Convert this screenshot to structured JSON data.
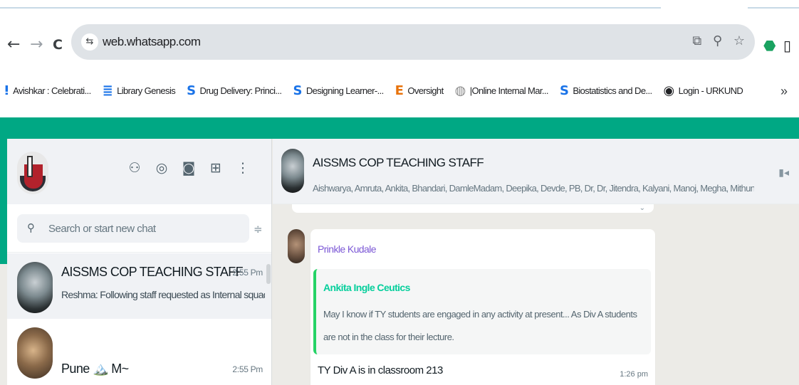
{
  "browser": {
    "nav": {
      "back_icon": "←",
      "forward_icon": "→",
      "reload_icon": "C"
    },
    "omnibox": {
      "site_info_icon": "⇆",
      "url": "web.whatsapp.com",
      "icons": [
        "install-app-icon",
        "zoom-icon",
        "bookmark-star-icon"
      ]
    },
    "extensions": [
      "extension-icon",
      "side-panel-icon"
    ],
    "bookmarks": [
      {
        "icon": "ⵑ",
        "icon_name": "avishkar-favicon",
        "label": "Avishkar : Celebrati...",
        "color": "#1a73e8"
      },
      {
        "icon": "≣",
        "icon_name": "library-genesis-favicon",
        "label": "Library Genesis",
        "color": "#1a73e8"
      },
      {
        "icon": "S",
        "icon_name": "scribd-favicon",
        "label": "Drug Delivery: Princi...",
        "color": "#1a73e8"
      },
      {
        "icon": "S",
        "icon_name": "scribd-favicon",
        "label": "Designing Learner-...",
        "color": "#1a73e8"
      },
      {
        "icon": "E",
        "icon_name": "oversight-favicon",
        "label": "Oversight",
        "color": "#e8730c"
      },
      {
        "icon": "◍",
        "icon_name": "online-internal-favicon",
        "label": "|Online Internal Mar...",
        "color": "#8a8a8a"
      },
      {
        "icon": "S",
        "icon_name": "scribd-favicon",
        "label": "Biostatistics and De...",
        "color": "#1a73e8"
      },
      {
        "icon": "◉",
        "icon_name": "urkund-favicon",
        "label": "Login - URKUND",
        "color": "#202124"
      }
    ],
    "bookmarks_more": "»"
  },
  "whatsapp": {
    "accent_color": "#00a884",
    "sidebar": {
      "header_icons": [
        {
          "name": "communities-icon",
          "glyph": "⚇"
        },
        {
          "name": "status-icon",
          "glyph": "◎"
        },
        {
          "name": "channels-icon",
          "glyph": "◙"
        },
        {
          "name": "new-chat-icon",
          "glyph": "⊞"
        },
        {
          "name": "menu-icon",
          "glyph": "⋮"
        }
      ],
      "search": {
        "placeholder": "Search or start new chat",
        "icon": "⚲",
        "filter_icon": "≑"
      },
      "chats": [
        {
          "name": "AISSMS COP TEACHING STAFF",
          "time": "2:55 Pm",
          "preview": "Reshma: Following staff requested as Internal squad ..."
        },
        {
          "name": "Pune 🏔️ M~",
          "time": "2:55 Pm",
          "preview": ""
        }
      ]
    },
    "conversation": {
      "title": "AISSMS COP TEACHING STAFF",
      "members": "Aishwarya, Amruta, Ankita, Bhandari, DamleMadam, Deepika, Devde, PB, Dr, Dr, Jitendra, Kalyani, Manoj, Megha, Mithun, Nikita, N...",
      "video_icon": "▮◂",
      "message": {
        "sender": "Prinkle Kudale",
        "quoted_author": "Ankita Ingle Ceutics",
        "quoted_text": "May I know if TY students are engaged in any activity at present... As Div A students are not in the class for their lecture.",
        "text": "TY Div A is in classroom 213",
        "time": "1:26 pm"
      }
    }
  }
}
